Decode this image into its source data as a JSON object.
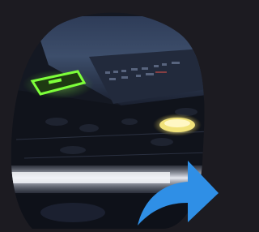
{
  "photo": {
    "subject": "dj-mixer-closeup",
    "colors": {
      "background": "#1c1b21",
      "panel_top": "#3d4e6b",
      "panel_dark": "#121620",
      "green_display": "#7dff3a",
      "yellow_button": "#f1e27a",
      "light_streak": "#d9dde6"
    }
  },
  "share_button": {
    "icon": "share-arrow-icon",
    "color": "#2f8fe6"
  }
}
